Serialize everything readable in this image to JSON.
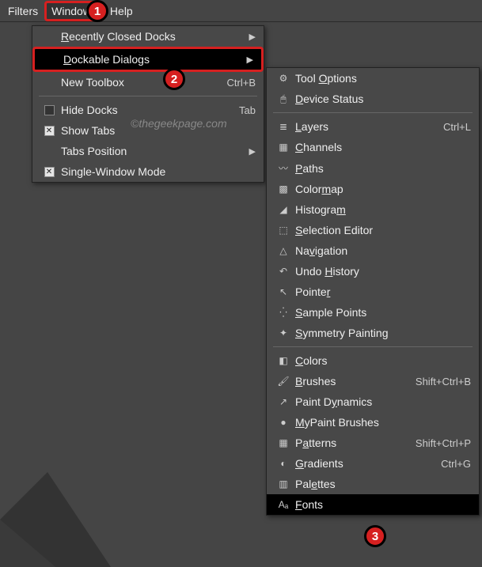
{
  "menubar": {
    "filters": "Filters",
    "windows": "Windows",
    "help": "Help"
  },
  "menu1": {
    "recent": "Recently Closed Docks",
    "dockable": "Dockable Dialogs",
    "new_toolbox": "New Toolbox",
    "new_toolbox_accel": "Ctrl+B",
    "hide_docks": "Hide Docks",
    "hide_docks_accel": "Tab",
    "show_tabs": "Show Tabs",
    "tabs_position": "Tabs Position",
    "single_window": "Single-Window Mode"
  },
  "menu2": {
    "tool_options": "Tool Options",
    "device_status": "Device Status",
    "layers": "Layers",
    "layers_accel": "Ctrl+L",
    "channels": "Channels",
    "paths": "Paths",
    "colormap": "Colormap",
    "histogram": "Histogram",
    "selection_editor": "Selection Editor",
    "navigation": "Navigation",
    "undo_history": "Undo History",
    "pointer": "Pointer",
    "sample_points": "Sample Points",
    "symmetry_painting": "Symmetry Painting",
    "colors": "Colors",
    "brushes": "Brushes",
    "brushes_accel": "Shift+Ctrl+B",
    "paint_dynamics": "Paint Dynamics",
    "mypaint_brushes": "MyPaint Brushes",
    "patterns": "Patterns",
    "patterns_accel": "Shift+Ctrl+P",
    "gradients": "Gradients",
    "gradients_accel": "Ctrl+G",
    "palettes": "Palettes",
    "fonts": "Fonts"
  },
  "callouts": {
    "c1": "1",
    "c2": "2",
    "c3": "3"
  },
  "watermark": "©thegeekpage.com"
}
